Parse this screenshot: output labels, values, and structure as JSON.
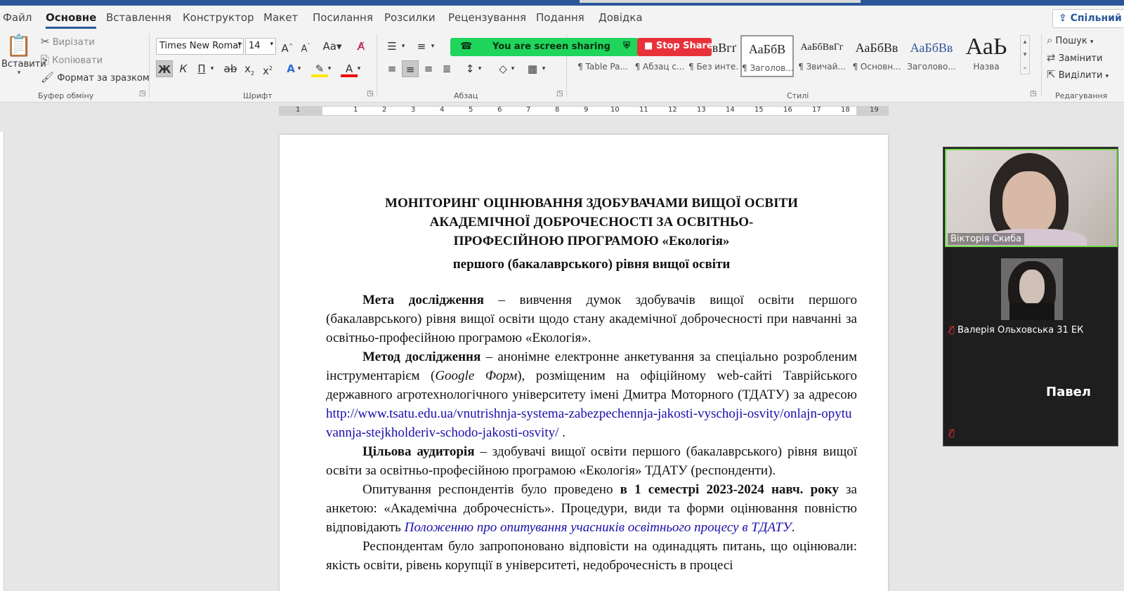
{
  "menu": {
    "tabs": [
      "Файл",
      "Основне",
      "Вставлення",
      "Конструктор",
      "Макет",
      "Посилання",
      "Розсилки",
      "Рецензування",
      "Подання",
      "Довідка"
    ],
    "active": "Основне",
    "share_label": "Спільний д"
  },
  "clipboard": {
    "paste": "Вставити",
    "cut": "Вирізати",
    "copy": "Копіювати",
    "format_painter": "Формат за зразком",
    "group_label": "Буфер обміну"
  },
  "font": {
    "name": "Times New Romar",
    "size": "14",
    "bold": "Ж",
    "italic": "К",
    "underline": "П",
    "group_label": "Шрифт"
  },
  "paragraph": {
    "group_label": "Абзац"
  },
  "styles": {
    "items": [
      {
        "sample": "вВгґ",
        "name": "¶ Table Pa..."
      },
      {
        "sample": "",
        "name": "¶ Абзац с..."
      },
      {
        "sample": "",
        "name": "¶ Без инте..."
      },
      {
        "sample": "АаБбВ",
        "name": "¶ Заголов..."
      },
      {
        "sample": "АаБбВвГг",
        "name": "¶ Звичай..."
      },
      {
        "sample": "АаБбВв",
        "name": "¶ Основн..."
      },
      {
        "sample": "АаБбВв",
        "name": "Заголово..."
      },
      {
        "sample": "АаЬ",
        "name": "Назва"
      }
    ],
    "group_label": "Стилі"
  },
  "editing": {
    "find": "Пошук",
    "replace": "Замінити",
    "select": "Виділити",
    "group_label": "Редагування"
  },
  "screenshare": {
    "status": "You are screen sharing",
    "stop": "Stop Share"
  },
  "ruler": {
    "numbers": [
      "1",
      "1",
      "2",
      "3",
      "4",
      "5",
      "6",
      "7",
      "8",
      "9",
      "10",
      "11",
      "12",
      "13",
      "14",
      "15",
      "16",
      "17",
      "18",
      "19"
    ]
  },
  "document": {
    "title_l1": "МОНІТОРИНГ ОЦІНЮВАННЯ ЗДОБУВАЧАМИ ВИЩОЇ ОСВІТИ",
    "title_l2": "АКАДЕМІЧНОЇ ДОБРОЧЕСНОСТІ ЗА ОСВІТНЬО-",
    "title_l3": "ПРОФЕСІЙНОЮ ПРОГРАМОЮ «Екологія»",
    "subtitle": "першого (бакалаврського) рівня вищої освіти",
    "p1_bold": "Мета дослідження",
    "p1_text": " – вивчення думок здобувачів вищої освіти першого (бакалаврського) рівня вищої освіти щодо стану академічної доброчесності при навчанні за освітньо-професійною програмою «Екологія».",
    "p2_bold": "Метод дослідження",
    "p2_text1": " – анонімне електронне анкетування за спеціально розробленим інструментарієм (",
    "p2_italic": "Google Форм",
    "p2_text2": "), розміщеним на офіційному web-сайті Таврійського державного агротехнологічного університету імені Дмитра Моторного (ТДАТУ) за адресою ",
    "p2_link": "http://www.tsatu.edu.ua/vnutrishnja-systema-zabezpechennja-jakosti-vyschoji-osvity/onlajn-opytuvannja-stejkholderiv-schodo-jakosti-osvity/",
    "p2_end": " .",
    "p3_bold": "Цільова аудиторія",
    "p3_text": " – здобувачі вищої освіти першого (бакалаврського) рівня вищої освіти за  освітньо-професійною програмою «Екологія» ТДАТУ (респонденти).",
    "p4_text1": "Опитування респондентів було проведено ",
    "p4_bold": "в 1 семестрі 2023-2024 навч. року",
    "p4_text2": " за анкетою: «Академічна доброчесність». Процедури, види та форми оцінювання повністю відповідають ",
    "p4_link": "Положенню про опитування учасників освітнього процесу в ТДАТУ",
    "p4_end": ".",
    "p5_text": "Респондентам було запропоновано відповісти на одинадцять питань, що оцінювали: якість освіти, рівень корупції в університеті, недоброчесність в процесі"
  },
  "participants": [
    {
      "name": "Вікторія Скиба"
    },
    {
      "name": "Валерія Ольховська 31 ЕК"
    },
    {
      "name": "Павел"
    }
  ]
}
